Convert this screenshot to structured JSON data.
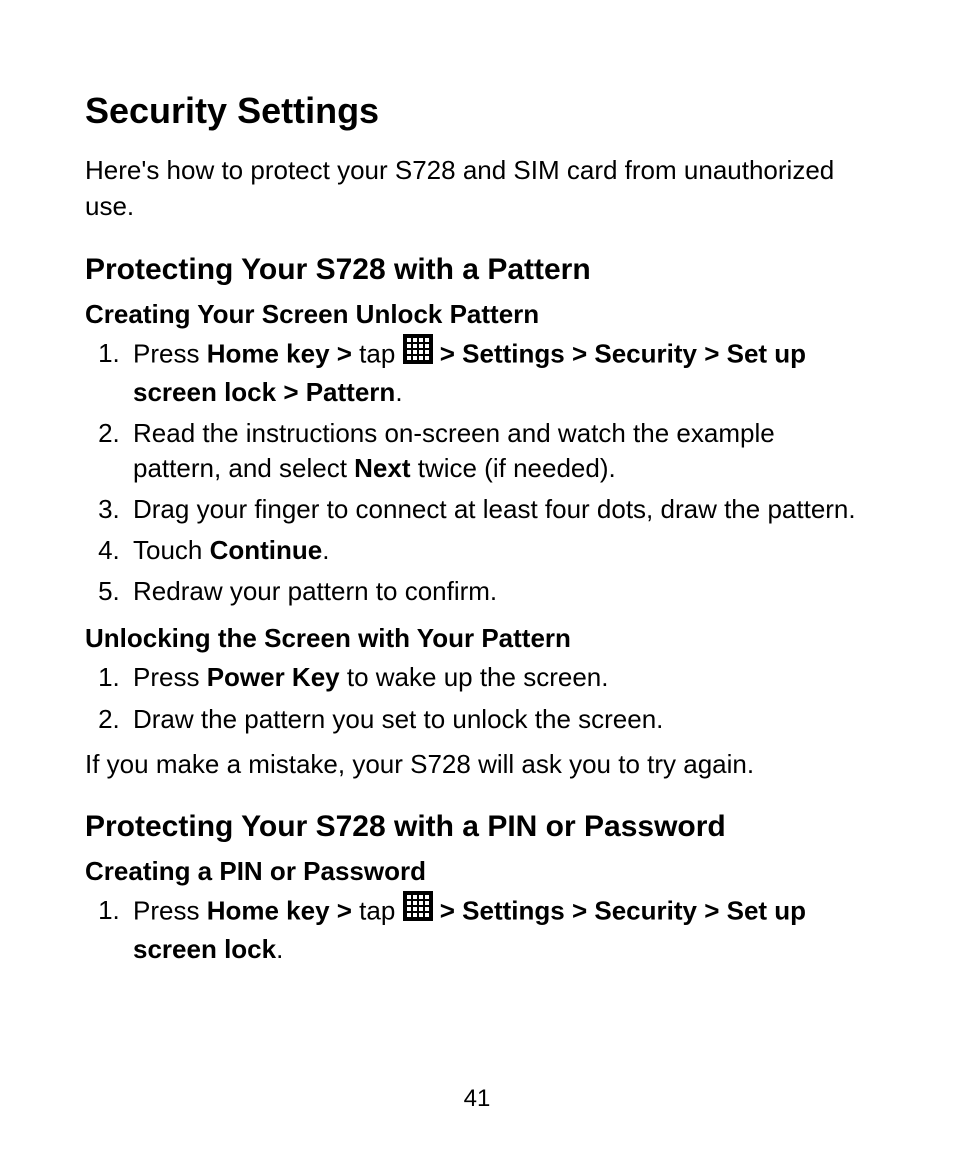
{
  "title": "Security Settings",
  "intro": "Here's how to protect your S728 and SIM card from unauthorized use.",
  "section1": {
    "heading": "Protecting Your S728 with a Pattern",
    "sub1": {
      "heading": "Creating Your Screen Unlock Pattern",
      "step1": {
        "pre": "Press ",
        "b1": "Home key > ",
        "mid": "tap ",
        "b2": " > Settings > Security > Set up screen lock > Pattern",
        "post": "."
      },
      "step2": {
        "pre": "Read the instructions on-screen and watch the example pattern, and select ",
        "b1": "Next",
        "post": " twice (if needed)."
      },
      "step3": "Drag your finger to connect at least four dots, draw the pattern.",
      "step4": {
        "pre": "Touch ",
        "b1": "Continue",
        "post": "."
      },
      "step5": "Redraw your pattern to confirm."
    },
    "sub2": {
      "heading": "Unlocking the Screen with Your Pattern",
      "step1": {
        "pre": "Press ",
        "b1": "Power Key",
        "post": " to wake up the screen."
      },
      "step2": "Draw the pattern you set to unlock the screen.",
      "note": "If you make a mistake, your S728 will ask you to try again."
    }
  },
  "section2": {
    "heading": "Protecting Your S728 with a PIN or Password",
    "sub1": {
      "heading": "Creating a PIN or Password",
      "step1": {
        "pre": "Press ",
        "b1": "Home key > ",
        "mid": "tap ",
        "b2": " > Settings > Security > Set up screen lock",
        "post": "."
      }
    }
  },
  "page_number": "41"
}
